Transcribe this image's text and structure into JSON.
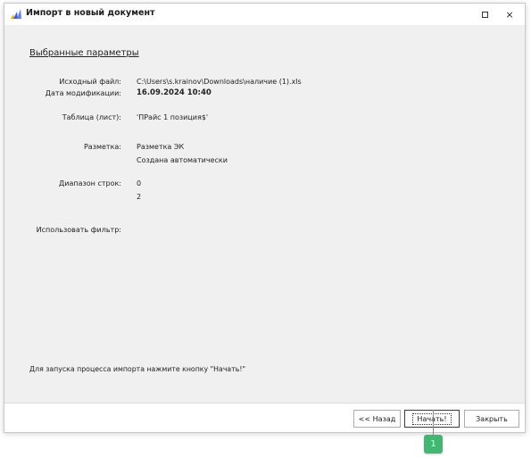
{
  "window": {
    "title": "Импорт в новый документ",
    "minimize_icon": "minimize-icon",
    "maximize_icon": "maximize-icon",
    "close_glyph": "×"
  },
  "params": {
    "section_title": "Выбранные параметры",
    "source_file_label": "Исходный файл:",
    "source_file_value": "C:\\Users\\s.krainov\\Downloads\\наличие (1).xls",
    "mod_date_label": "Дата модификации:",
    "mod_date_value": "16.09.2024 10:40",
    "table_label": "Таблица (лист):",
    "table_value": "'ПРайс 1 позиция$'",
    "markup_label": "Разметка:",
    "markup_value": "Разметка ЭК",
    "markup_note": "Создана автоматически",
    "range_label": "Диапазон строк:",
    "range_from": "0",
    "range_to": "2",
    "filter_label": "Использовать фильтр:"
  },
  "hint": "Для запуска процесса импорта нажмите кнопку \"Начать!\"",
  "footer": {
    "back_label": "<< Назад",
    "start_label": "Начать!",
    "close_label": "Закрыть"
  },
  "callout": {
    "number": "1",
    "color": "#3fb872"
  },
  "colors": {
    "accent": "#3fb872",
    "icon_blue": "#3b5bdb",
    "icon_orange": "#f59f00"
  }
}
